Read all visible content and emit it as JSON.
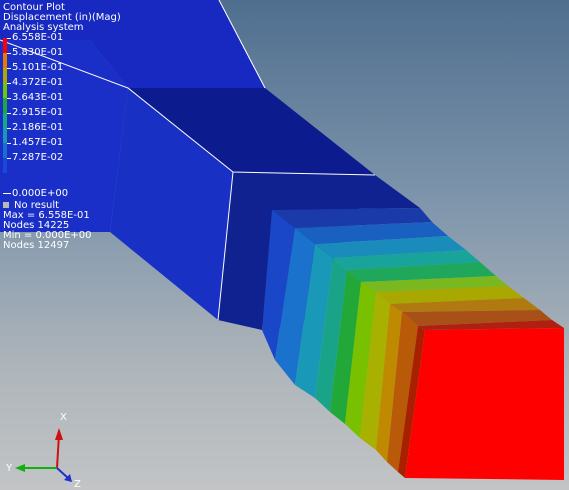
{
  "legend": {
    "title": "Contour Plot",
    "subtitle": "Displacement (in)(Mag)",
    "system": "Analysis system",
    "levels": [
      {
        "label": "6.558E-01",
        "color": "#ff0000"
      },
      {
        "label": "5.830E-01",
        "color": "#e87a00"
      },
      {
        "label": "5.101E-01",
        "color": "#b0a800"
      },
      {
        "label": "4.372E-01",
        "color": "#6ec800"
      },
      {
        "label": "3.643E-01",
        "color": "#1fa83a"
      },
      {
        "label": "2.915E-01",
        "color": "#19a882"
      },
      {
        "label": "2.186E-01",
        "color": "#1a9ab0"
      },
      {
        "label": "1.457E-01",
        "color": "#1a6ed0"
      },
      {
        "label": "7.287E-02",
        "color": "#1a48d8"
      }
    ],
    "zero_label": "0.000E+00",
    "no_result_label": "No result",
    "max_label": "Max = 6.558E-01",
    "max_nodes": "Nodes 14225",
    "min_label": "Min = 0.000E+00",
    "min_nodes": "Nodes 12497"
  },
  "triad": {
    "x": "X",
    "y": "Y",
    "z": "Z"
  },
  "colors": {
    "model_dark_blue": "#0a1a9a",
    "model_blue": "#1a2ec8",
    "accent_red": "#ff0000"
  }
}
